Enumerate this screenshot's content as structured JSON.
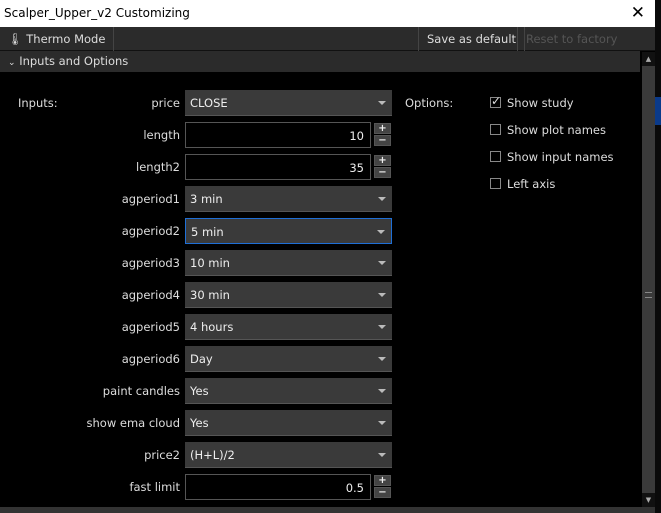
{
  "window": {
    "title": "Scalper_Upper_v2 Customizing"
  },
  "toolbar": {
    "thermo": "Thermo Mode",
    "save_default": "Save as default",
    "reset": "Reset to factory default"
  },
  "section": {
    "title": "Inputs and Options"
  },
  "inputs_label": "Inputs:",
  "options_label": "Options:",
  "inputs": [
    {
      "label": "price",
      "type": "select",
      "value": "CLOSE"
    },
    {
      "label": "length",
      "type": "number",
      "value": "10"
    },
    {
      "label": "length2",
      "type": "number",
      "value": "35"
    },
    {
      "label": "agperiod1",
      "type": "select",
      "value": "3 min"
    },
    {
      "label": "agperiod2",
      "type": "select",
      "value": "5 min",
      "focused": true
    },
    {
      "label": "agperiod3",
      "type": "select",
      "value": "10 min"
    },
    {
      "label": "agperiod4",
      "type": "select",
      "value": "30 min"
    },
    {
      "label": "agperiod5",
      "type": "select",
      "value": "4 hours"
    },
    {
      "label": "agperiod6",
      "type": "select",
      "value": "Day"
    },
    {
      "label": "paint candles",
      "type": "select",
      "value": "Yes"
    },
    {
      "label": "show ema cloud",
      "type": "select",
      "value": "Yes"
    },
    {
      "label": "price2",
      "type": "select",
      "value": "(H+L)/2"
    },
    {
      "label": "fast limit",
      "type": "number",
      "value": "0.5"
    }
  ],
  "options": [
    {
      "label": "Show study",
      "checked": true
    },
    {
      "label": "Show plot names",
      "checked": false
    },
    {
      "label": "Show input names",
      "checked": false
    },
    {
      "label": "Left axis",
      "checked": false
    }
  ]
}
